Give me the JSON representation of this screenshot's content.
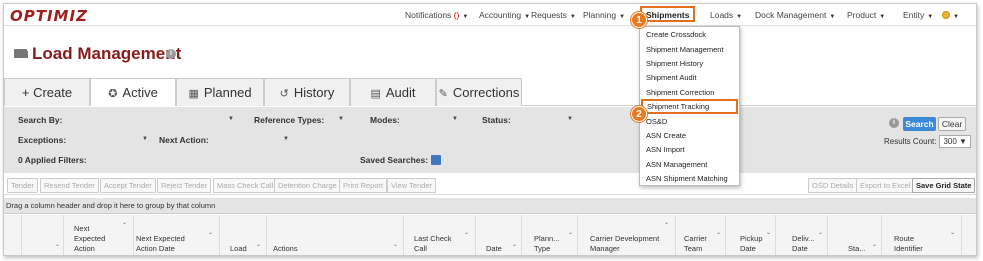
{
  "app": {
    "logo": "OPTIMIZ"
  },
  "nav": {
    "notifications_label": "Notifications",
    "notifications_count": "()",
    "accounting": "Accounting",
    "requests": "Requests",
    "planning": "Planning",
    "shipments": "Shipments",
    "loads": "Loads",
    "dock_management": "Dock Management",
    "product": "Product",
    "entity": "Entity"
  },
  "page": {
    "title": "Load Management"
  },
  "tabs": [
    {
      "label": "+ Create",
      "icon": ""
    },
    {
      "label": "Active",
      "icon": "gear-icon"
    },
    {
      "label": "Planned",
      "icon": "calendar-icon"
    },
    {
      "label": "History",
      "icon": "history-icon"
    },
    {
      "label": "Audit",
      "icon": "clipboard-icon"
    },
    {
      "label": "Corrections",
      "icon": "pencil-icon"
    }
  ],
  "filters": {
    "search_by": "Search By:",
    "reference_types": "Reference Types:",
    "modes": "Modes:",
    "status": "Status:",
    "exceptions": "Exceptions:",
    "next_action": "Next Action:",
    "applied_filters": "0 Applied Filters:",
    "saved_searches": "Saved Searches:",
    "search_button": "Search",
    "clear_button": "Clear",
    "results_count_label": "Results Count:",
    "results_count_value": "300"
  },
  "toolbar": {
    "tender": "Tender",
    "resend_tender": "Resend Tender",
    "accept_tender": "Accept Tender",
    "reject_tender": "Reject Tender",
    "mass_check_call": "Mass Check Call",
    "detention_charge": "Detention Charge",
    "print_report": "Print Report",
    "view_tender": "View Tender",
    "osd_details": "OSD Details",
    "export_to_excel": "Export to Excel",
    "save_grid_state": "Save Grid State"
  },
  "grid": {
    "group_hint": "Drag a column header and drop it here to group by that column",
    "columns": [
      "Next Expected Action",
      "Next Expected Action Date",
      "Load",
      "Actions",
      "Last Check Call",
      "Date",
      "Plann... Type",
      "Carrier Development Manager",
      "Carrier Team",
      "Pickup Date",
      "Deliv... Date",
      "Sta...",
      "Route Identifier"
    ]
  },
  "shipments_menu": {
    "items": [
      "Create Crossdock",
      "Shipment Management",
      "Shipment History",
      "Shipment Audit",
      "Shipment Correction",
      "Shipment Tracking",
      "OS&D",
      "ASN Create",
      "ASN Import",
      "ASN Management",
      "ASN Shipment Matching"
    ]
  },
  "callouts": {
    "step1": "1",
    "step2": "2"
  },
  "colors": {
    "brand": "#8b1a1a",
    "highlight": "#e0701d",
    "search": "#3a8ad8"
  }
}
